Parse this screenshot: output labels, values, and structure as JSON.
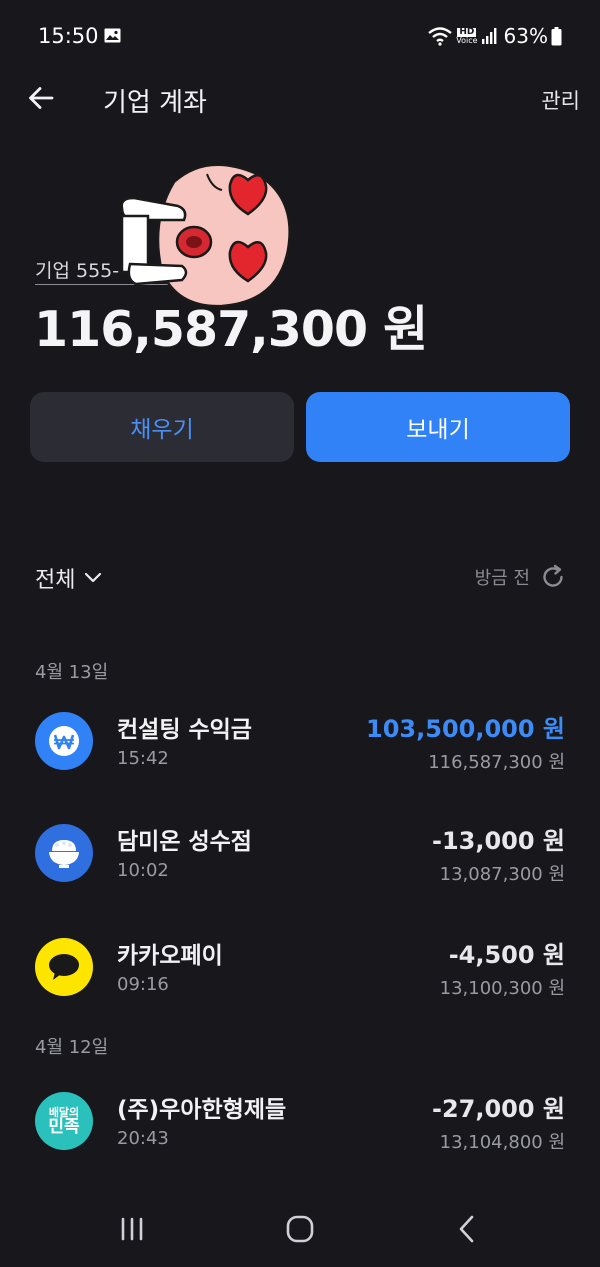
{
  "status": {
    "time": "15:50",
    "battery": "63%",
    "hd_label": "HD",
    "voice_label": "Voice"
  },
  "header": {
    "title": "기업 계좌",
    "manage": "관리"
  },
  "account": {
    "name": "기업 555-",
    "balance": "116,587,300 원"
  },
  "actions": {
    "fill": "채우기",
    "send": "보내기"
  },
  "filter": {
    "label": "전체",
    "refresh_text": "방금 전"
  },
  "groups": [
    {
      "date": "4월 13일",
      "transactions": [
        {
          "name": "컨설팅 수익금",
          "time": "15:42",
          "amount": "103,500,000 원",
          "balance": "116,587,300 원",
          "icon": "won-icon"
        },
        {
          "name": "담미온 성수점",
          "time": "10:02",
          "amount": "-13,000 원",
          "balance": "13,087,300 원",
          "icon": "rice-bowl-icon"
        },
        {
          "name": "카카오페이",
          "time": "09:16",
          "amount": "-4,500 원",
          "balance": "13,100,300 원",
          "icon": "kakaopay-icon"
        }
      ]
    },
    {
      "date": "4월 12일",
      "transactions": [
        {
          "name": "(주)우아한형제들",
          "time": "20:43",
          "amount": "-27,000 원",
          "balance": "13,104,800 원",
          "icon": "baemin-icon",
          "logo_text_top": "배달의",
          "logo_text_bottom": "민족"
        }
      ]
    }
  ],
  "colors": {
    "background": "#17171c",
    "accent": "#3182f6",
    "positive": "#3d8bf6"
  }
}
